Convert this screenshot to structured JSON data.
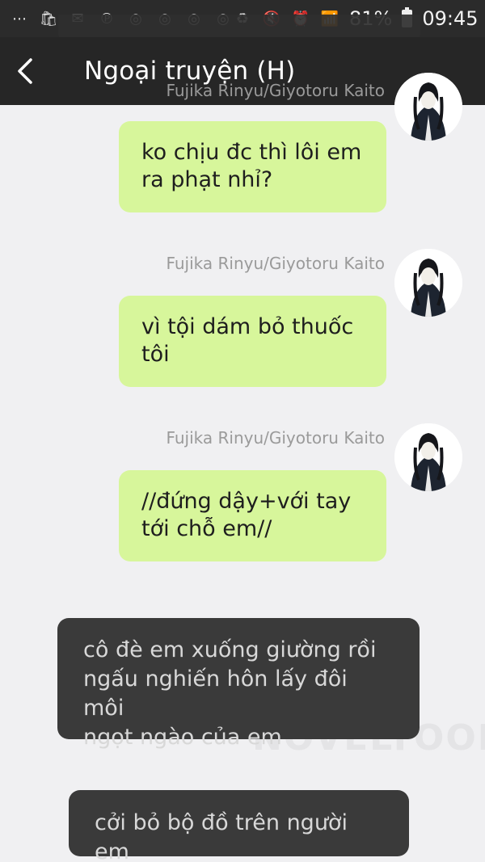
{
  "status_bar": {
    "battery": "81%",
    "time": "09:45",
    "icons": [
      "more-icon",
      "shop-icon",
      "message-icon",
      "pinterest-icon",
      "chrome-icon",
      "chrome-icon",
      "chrome-icon",
      "chrome-icon",
      "recycle-icon",
      "mute-icon",
      "alarm-icon",
      "wifi-icon",
      "signal-icon",
      "battery-icon"
    ]
  },
  "header": {
    "title": "Ngoại truyện (H)"
  },
  "messages": [
    {
      "sender": "Fujika Rinyu/Giyotoru Kaito",
      "lines": [
        "ko chịu đc thì lôi em",
        "ra phạt nhỉ?"
      ]
    },
    {
      "sender": "Fujika Rinyu/Giyotoru Kaito",
      "lines": [
        "vì tội dám bỏ thuốc",
        "tôi"
      ]
    },
    {
      "sender": "Fujika Rinyu/Giyotoru Kaito",
      "lines": [
        "//đứng dậy+với tay",
        "tới chỗ em//"
      ]
    }
  ],
  "narrations": [
    {
      "lines": [
        "cô đè em xuống giường rồi",
        "ngấu nghiến hôn lấy đôi môi",
        "ngọt ngào của em"
      ]
    },
    {
      "lines": [
        "cởi bỏ bộ đồ trên người em"
      ]
    }
  ],
  "watermark": "NOVELTOON",
  "colors": {
    "bubble": "#d7f69b",
    "narration": "#3a3a3a",
    "header": "#262626",
    "background": "#f0f0f2"
  }
}
